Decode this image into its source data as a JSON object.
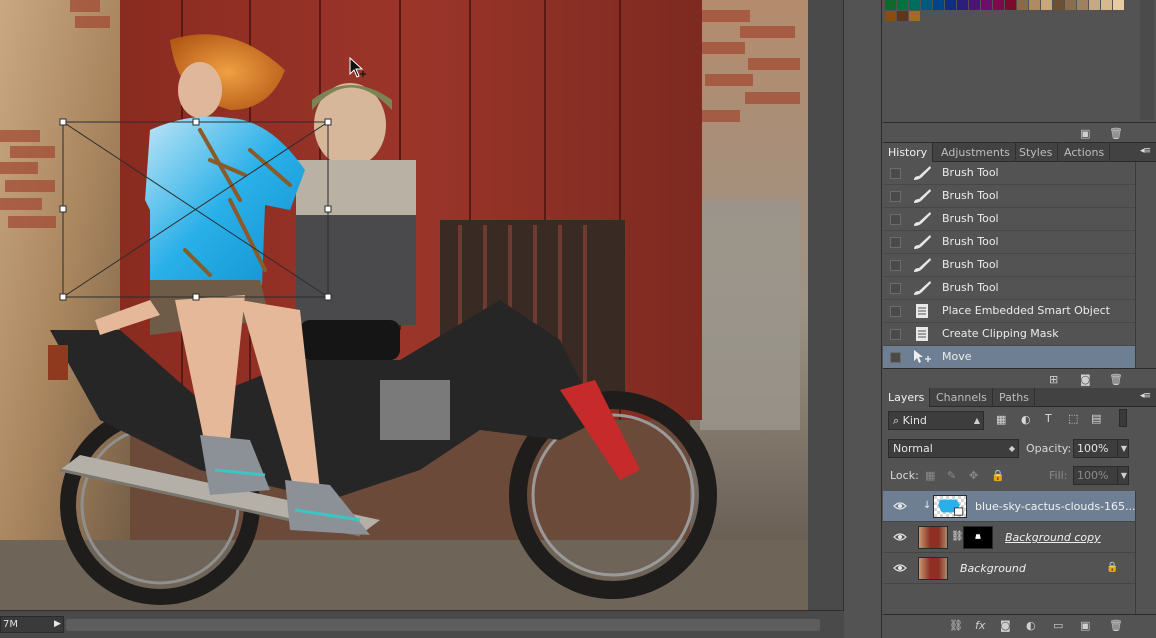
{
  "document": {
    "size_readout": "7M"
  },
  "panels": {
    "history_tabs": [
      {
        "label": "History",
        "active": true
      },
      {
        "label": "Adjustments",
        "active": false
      },
      {
        "label": "Styles",
        "active": false
      },
      {
        "label": "Actions",
        "active": false
      }
    ],
    "history_items": [
      {
        "label": "Brush Tool",
        "icon": "brush-icon",
        "selected": false
      },
      {
        "label": "Brush Tool",
        "icon": "brush-icon",
        "selected": false
      },
      {
        "label": "Brush Tool",
        "icon": "brush-icon",
        "selected": false
      },
      {
        "label": "Brush Tool",
        "icon": "brush-icon",
        "selected": false
      },
      {
        "label": "Brush Tool",
        "icon": "brush-icon",
        "selected": false
      },
      {
        "label": "Brush Tool",
        "icon": "brush-icon",
        "selected": false
      },
      {
        "label": "Place Embedded Smart Object",
        "icon": "document-icon",
        "selected": false
      },
      {
        "label": "Create Clipping Mask",
        "icon": "document-icon",
        "selected": false
      },
      {
        "label": "Move",
        "icon": "move-icon",
        "selected": true
      }
    ],
    "layers_tabs": [
      {
        "label": "Layers",
        "active": true
      },
      {
        "label": "Channels",
        "active": false
      },
      {
        "label": "Paths",
        "active": false
      }
    ],
    "layers_filter": {
      "label": "Kind"
    },
    "blend_mode": "Normal",
    "opacity_label": "Opacity:",
    "opacity_value": "100%",
    "lock_label": "Lock:",
    "fill_label": "Fill:",
    "fill_value": "100%",
    "layers": [
      {
        "name": "blue-sky-cactus-clouds-165...",
        "selected": true,
        "italic": false,
        "underline": false,
        "clipped": true,
        "locked": false
      },
      {
        "name": "Background copy",
        "selected": false,
        "italic": true,
        "underline": true,
        "clipped": false,
        "locked": false
      },
      {
        "name": "Background",
        "selected": false,
        "italic": true,
        "underline": false,
        "clipped": false,
        "locked": true
      }
    ]
  },
  "colors": {
    "panel_bg": "#535353",
    "selected_row": "#6f7f93",
    "tab_bar": "#424242",
    "wood_red": "#8f2f23",
    "shirt_blue": "#2ab0e8"
  }
}
